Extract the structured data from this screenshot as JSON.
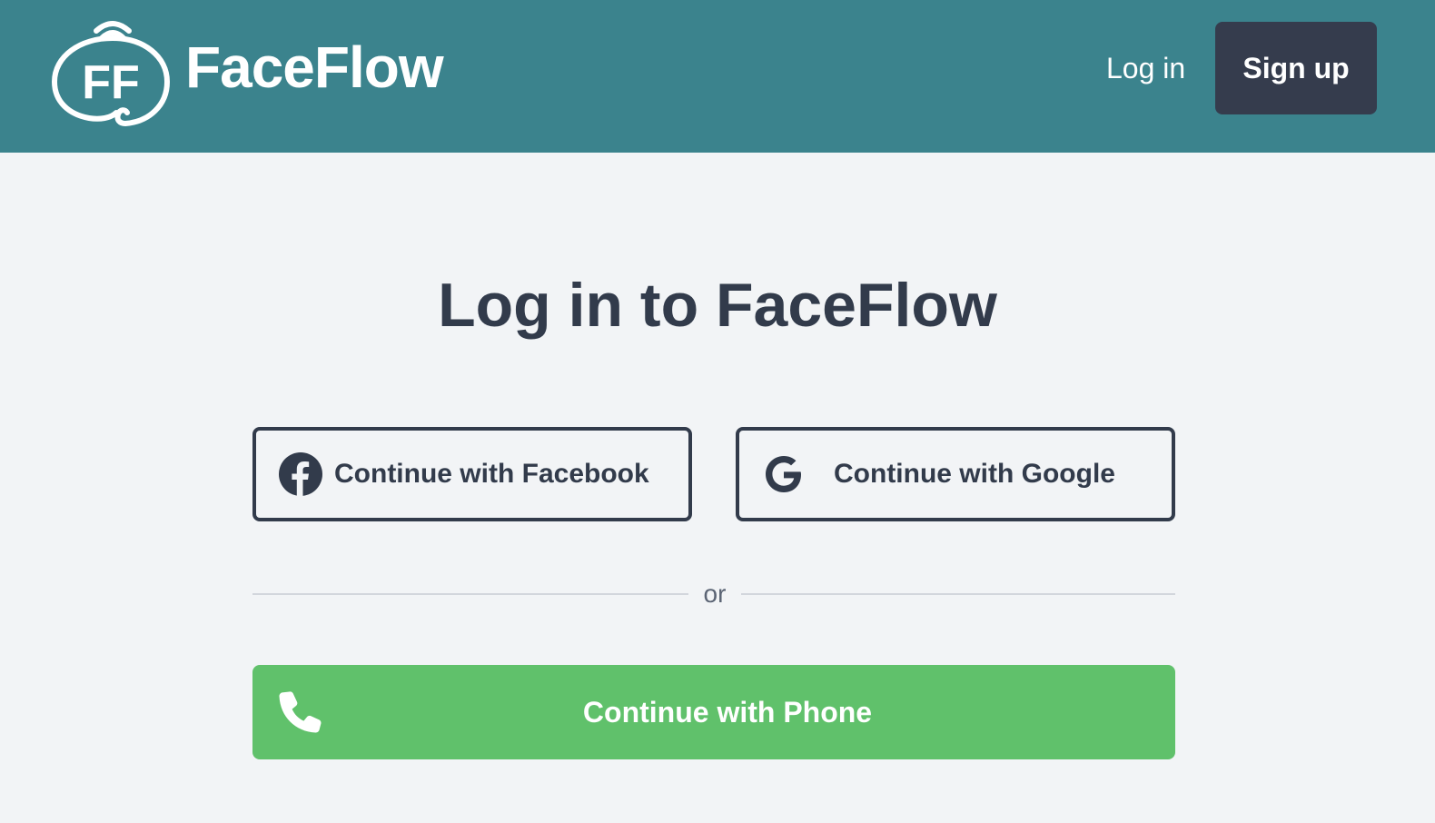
{
  "header": {
    "logo_monogram": "FF",
    "logo_text": "FaceFlow",
    "login_label": "Log in",
    "signup_label": "Sign up"
  },
  "main": {
    "title": "Log in to FaceFlow",
    "facebook_label": "Continue with Facebook",
    "google_label": "Continue with Google",
    "divider_text": "or",
    "phone_label": "Continue with Phone"
  },
  "icons": {
    "logo": "faceflow-logo-icon",
    "facebook": "facebook-icon",
    "google": "google-icon",
    "phone": "phone-icon"
  },
  "colors": {
    "header_bg": "#3b838d",
    "signup_bg": "#353c4d",
    "page_bg": "#f2f4f6",
    "text_dark": "#323b4b",
    "phone_green": "#60c16b",
    "divider": "#d2d6dc"
  }
}
